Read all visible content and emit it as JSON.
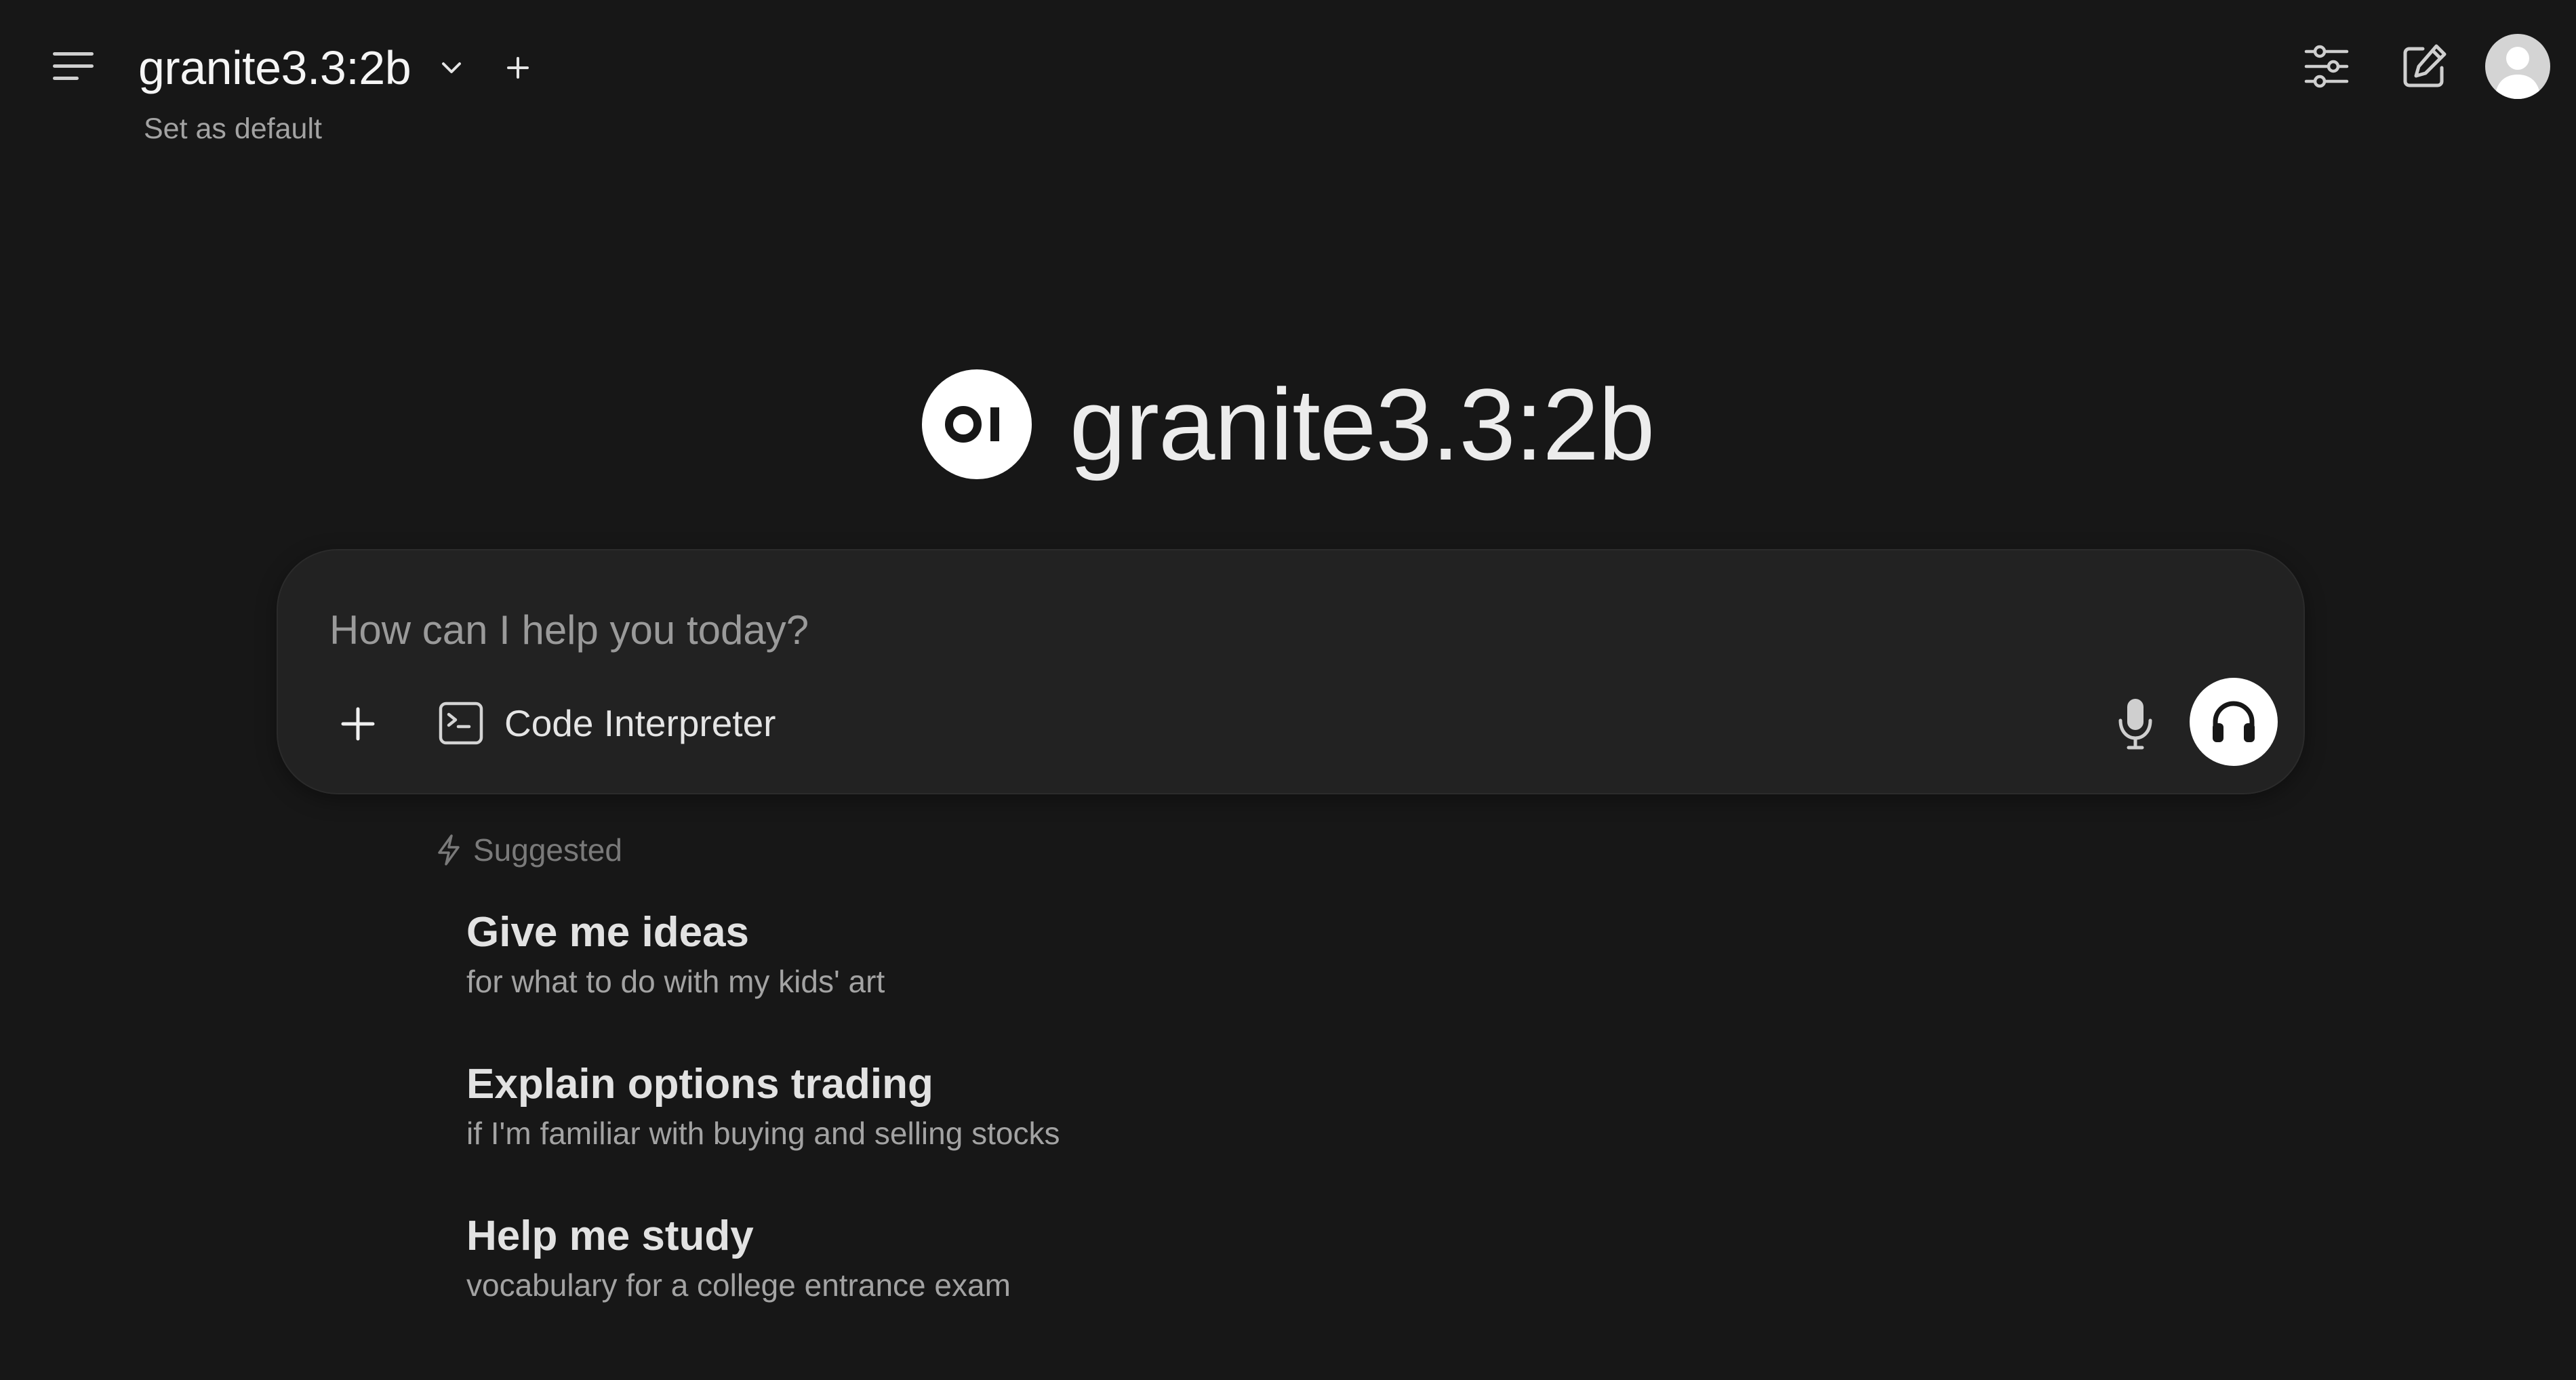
{
  "header": {
    "model_name": "granite3.3:2b",
    "set_default_label": "Set as default"
  },
  "icons": {
    "menu": "menu-icon",
    "chevron": "chevron-down-icon",
    "add_model": "plus-icon",
    "controls": "sliders-icon",
    "new_chat": "edit-icon",
    "avatar": "user-avatar-icon",
    "logo": "open-webui-logo",
    "attach": "plus-icon",
    "code": "terminal-icon",
    "mic": "microphone-icon",
    "voice": "headphones-icon",
    "suggested": "bolt-icon"
  },
  "hero": {
    "logo_text": "OI",
    "title": "granite3.3:2b"
  },
  "input": {
    "placeholder": "How can I help you today?",
    "value": "",
    "code_interpreter_label": "Code Interpreter"
  },
  "suggestions": {
    "header": "Suggested",
    "items": [
      {
        "title": "Give me ideas",
        "subtitle": "for what to do with my kids' art"
      },
      {
        "title": "Explain options trading",
        "subtitle": "if I'm familiar with buying and selling stocks"
      },
      {
        "title": "Help me study",
        "subtitle": "vocabulary for a college entrance exam"
      }
    ]
  },
  "colors": {
    "background": "#171717",
    "card": "#222222",
    "text": "#ececec",
    "muted": "#a3a3a3",
    "accent_white": "#ffffff"
  }
}
